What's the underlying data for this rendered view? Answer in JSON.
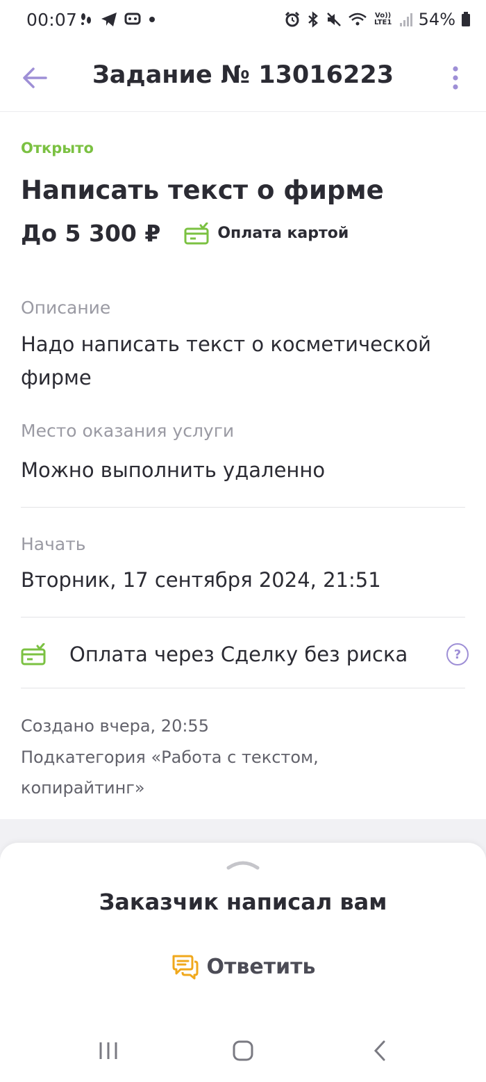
{
  "status_bar": {
    "time": "00:07",
    "battery": "54%",
    "network": "Vo)) LTE1"
  },
  "app_bar": {
    "title": "Задание № 13016223"
  },
  "task": {
    "status": "Открыто",
    "title": "Написать текст о фирме",
    "price": "До 5 300 ₽",
    "payment_method": "Оплата картой"
  },
  "sections": {
    "description_label": "Описание",
    "description_value": "Надо написать текст о косметической фирме",
    "place_label": "Место оказания услуги",
    "place_value": "Можно выполнить удаленно",
    "start_label": "Начать",
    "start_value": "Вторник, 17 сентября 2024, 21:51"
  },
  "safe_deal": {
    "label": "Оплата через Сделку без риска",
    "help": "?"
  },
  "meta": {
    "created": "Создано вчера, 20:55",
    "subcategory": "Подкатегория «Работа с текстом, копирайтинг»"
  },
  "sheet": {
    "title": "Заказчик написал вам",
    "reply_label": "Ответить"
  },
  "colors": {
    "accent": "#9e8fd6",
    "status_open": "#7bc142",
    "reply_icon": "#f0a81c"
  }
}
